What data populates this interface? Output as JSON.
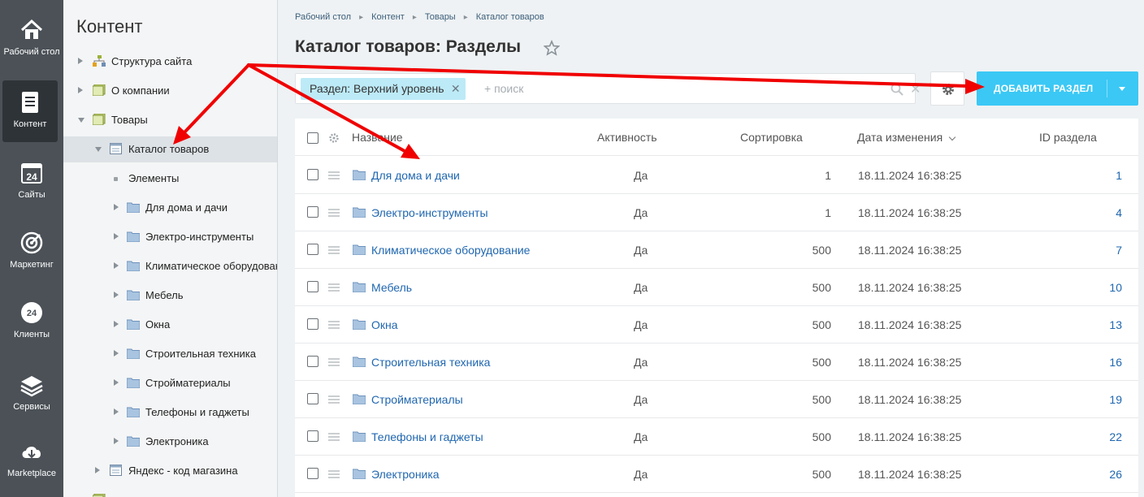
{
  "rail": {
    "items": [
      {
        "key": "desktop",
        "label": "Рабочий стол",
        "icon": "home-icon"
      },
      {
        "key": "content",
        "label": "Контент",
        "icon": "document-icon"
      },
      {
        "key": "sites",
        "label": "Сайты",
        "icon": "calendar-24-icon"
      },
      {
        "key": "marketing",
        "label": "Маркетинг",
        "icon": "target-icon"
      },
      {
        "key": "clients",
        "label": "Клиенты",
        "icon": "clients-24-icon"
      },
      {
        "key": "services",
        "label": "Сервисы",
        "icon": "layers-icon"
      },
      {
        "key": "marketplace",
        "label": "Marketplace",
        "icon": "cloud-download-icon"
      }
    ]
  },
  "tree": {
    "title": "Контент",
    "items": [
      {
        "label": "Структура сайта",
        "icon": "sitemap-icon"
      },
      {
        "label": "О компании",
        "icon": "iblock-icon"
      },
      {
        "label": "Товары",
        "icon": "iblock-icon"
      },
      {
        "label": "Каталог товаров",
        "icon": "catalog-icon"
      },
      {
        "label": "Элементы",
        "icon": "bullet-icon"
      },
      {
        "label": "Для дома и дачи",
        "icon": "folder-icon"
      },
      {
        "label": "Электро-инструменты",
        "icon": "folder-icon"
      },
      {
        "label": "Климатическое оборудование",
        "icon": "folder-icon"
      },
      {
        "label": "Мебель",
        "icon": "folder-icon"
      },
      {
        "label": "Окна",
        "icon": "folder-icon"
      },
      {
        "label": "Строительная техника",
        "icon": "folder-icon"
      },
      {
        "label": "Стройматериалы",
        "icon": "folder-icon"
      },
      {
        "label": "Телефоны и гаджеты",
        "icon": "folder-icon"
      },
      {
        "label": "Электроника",
        "icon": "folder-icon"
      },
      {
        "label": "Яндекс - код магазина",
        "icon": "catalog-icon"
      }
    ]
  },
  "breadcrumbs": [
    "Рабочий стол",
    "Контент",
    "Товары",
    "Каталог товаров"
  ],
  "page_title": "Каталог товаров: Разделы",
  "filter": {
    "chip": "Раздел: Верхний уровень",
    "placeholder": "+ поиск"
  },
  "add_button": "ДОБАВИТЬ РАЗДЕЛ",
  "table": {
    "headers": {
      "name": "Название",
      "active": "Активность",
      "sort": "Сортировка",
      "date": "Дата изменения",
      "id": "ID раздела"
    },
    "rows": [
      {
        "name": "Для дома и дачи",
        "active": "Да",
        "sort": "1",
        "date": "18.11.2024 16:38:25",
        "id": "1"
      },
      {
        "name": "Электро-инструменты",
        "active": "Да",
        "sort": "1",
        "date": "18.11.2024 16:38:25",
        "id": "4"
      },
      {
        "name": "Климатическое оборудование",
        "active": "Да",
        "sort": "500",
        "date": "18.11.2024 16:38:25",
        "id": "7"
      },
      {
        "name": "Мебель",
        "active": "Да",
        "sort": "500",
        "date": "18.11.2024 16:38:25",
        "id": "10"
      },
      {
        "name": "Окна",
        "active": "Да",
        "sort": "500",
        "date": "18.11.2024 16:38:25",
        "id": "13"
      },
      {
        "name": "Строительная техника",
        "active": "Да",
        "sort": "500",
        "date": "18.11.2024 16:38:25",
        "id": "16"
      },
      {
        "name": "Стройматериалы",
        "active": "Да",
        "sort": "500",
        "date": "18.11.2024 16:38:25",
        "id": "19"
      },
      {
        "name": "Телефоны и гаджеты",
        "active": "Да",
        "sort": "500",
        "date": "18.11.2024 16:38:25",
        "id": "22"
      },
      {
        "name": "Электроника",
        "active": "Да",
        "sort": "500",
        "date": "18.11.2024 16:38:25",
        "id": "26"
      }
    ]
  },
  "colors": {
    "accent": "#3bc8f5",
    "link": "#2067b0",
    "annotation_arrow": "#f00000"
  }
}
